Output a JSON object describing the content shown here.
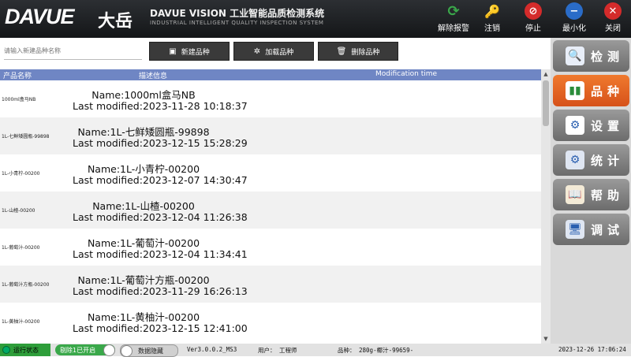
{
  "header": {
    "logo": "DAVUE",
    "logo_cn": "大岳",
    "title": "DAVUE VISION 工业智能品质检测系统",
    "subtitle": "INDUSTRIAL INTELLIGENT QUALITY INSPECTION SYSTEM",
    "tools": [
      {
        "label": "解除报警",
        "icon": "refresh-icon",
        "color": "#3aa84a"
      },
      {
        "label": "注销",
        "icon": "key-icon",
        "color": "#e6b422"
      },
      {
        "label": "停止",
        "icon": "stop-icon",
        "color": "#d42b2b"
      },
      {
        "label": "最小化",
        "icon": "minimize-icon",
        "color": "#2a6cc8"
      },
      {
        "label": "关闭",
        "icon": "close-icon",
        "color": "#d42b2b"
      }
    ]
  },
  "toolbar": {
    "search_placeholder": "请输入新建品种名称",
    "new_label": "新建品种",
    "load_label": "加载品种",
    "delete_label": "删除品种"
  },
  "table": {
    "columns": [
      "产品名称",
      "描述信息",
      "Modification time"
    ],
    "rows": [
      {
        "name": "1000ml盒马NB",
        "line1": "Name:1000ml盒马NB",
        "line2": "Last modified:2023-11-28 10:18:37"
      },
      {
        "name": "1L-七鲜矮圆瓶-99898",
        "line1": "Name:1L-七鲜矮圆瓶-99898",
        "line2": "Last modified:2023-12-15 15:28:29"
      },
      {
        "name": "1L-小青柠-00200",
        "line1": "Name:1L-小青柠-00200",
        "line2": "Last modified:2023-12-07 14:30:47"
      },
      {
        "name": "1L-山楂-00200",
        "line1": "Name:1L-山楂-00200",
        "line2": "Last modified:2023-12-04 11:26:38"
      },
      {
        "name": "1L-葡萄汁-00200",
        "line1": "Name:1L-葡萄汁-00200",
        "line2": "Last modified:2023-12-04 11:34:41"
      },
      {
        "name": "1L-葡萄汁方瓶-00200",
        "line1": "Name:1L-葡萄汁方瓶-00200",
        "line2": "Last modified:2023-11-29 16:26:13"
      },
      {
        "name": "1L-黄柚汁-00200",
        "line1": "Name:1L-黄柚汁-00200",
        "line2": "Last modified:2023-12-15 12:41:00"
      }
    ]
  },
  "sidebar": {
    "items": [
      {
        "label": "检测",
        "icon": "magnifier-icon"
      },
      {
        "label": "品种",
        "icon": "bar-chart-icon",
        "active": true
      },
      {
        "label": "设置",
        "icon": "settings-chart-icon"
      },
      {
        "label": "统计",
        "icon": "gears-icon"
      },
      {
        "label": "帮助",
        "icon": "book-icon"
      },
      {
        "label": "调试",
        "icon": "monitor-icon"
      }
    ]
  },
  "statusbar": {
    "run_state": "运行状态",
    "reject_toggle": "剔除1已开启",
    "data_hide_toggle": "数据隐藏",
    "version": "Ver3.0.0.2_MS3",
    "user": "用户： 工程师",
    "variety": "品种： 280g-椰汁-99659-",
    "datetime": "2023-12-26  17:06:24"
  }
}
